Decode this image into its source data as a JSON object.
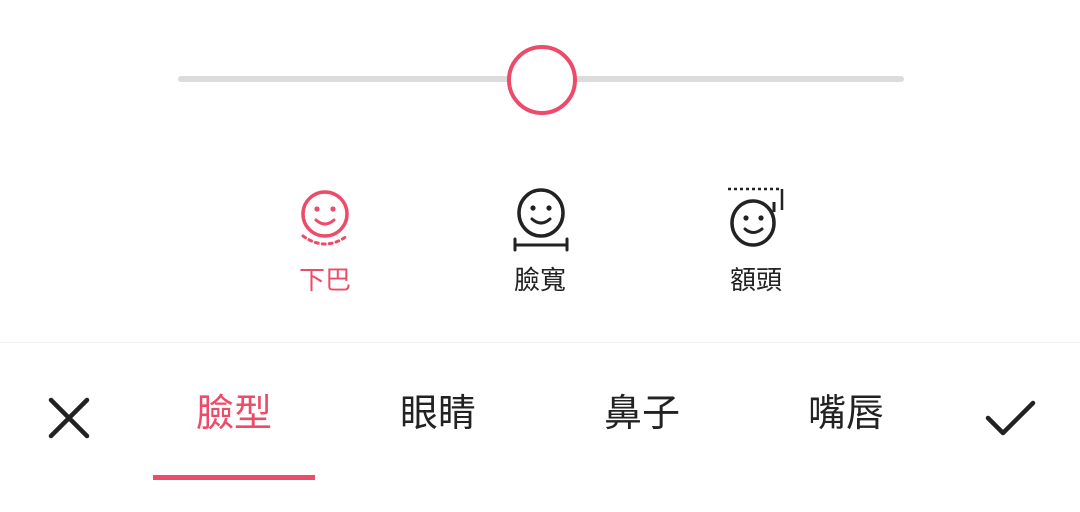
{
  "colors": {
    "accent": "#ec4c6a",
    "text": "#222222",
    "track": "#dcdcdc"
  },
  "slider": {
    "value": 0.5
  },
  "sub_options": [
    {
      "label": "下巴",
      "icon": "chin-face-icon",
      "active": true
    },
    {
      "label": "臉寬",
      "icon": "face-width-icon",
      "active": false
    },
    {
      "label": "額頭",
      "icon": "forehead-face-icon",
      "active": false
    }
  ],
  "bottom_bar": {
    "cancel_icon": "close-icon",
    "confirm_icon": "check-icon",
    "tabs": [
      {
        "label": "臉型",
        "active": true
      },
      {
        "label": "眼睛",
        "active": false
      },
      {
        "label": "鼻子",
        "active": false
      },
      {
        "label": "嘴唇",
        "active": false
      }
    ]
  }
}
